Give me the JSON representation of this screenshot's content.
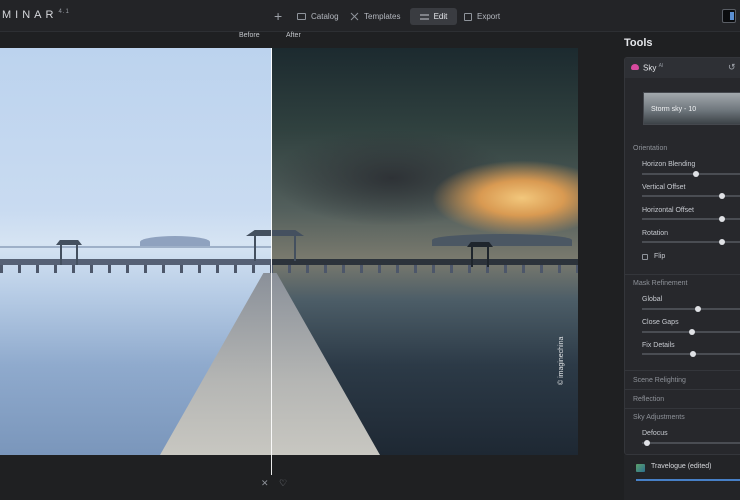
{
  "app": {
    "logo_text": "MINAR",
    "logo_version": "4.1"
  },
  "toolbar": {
    "add_label": "+",
    "catalog_label": "Catalog",
    "templates_label": "Templates",
    "edit_label": "Edit",
    "export_label": "Export"
  },
  "canvas": {
    "before_label": "Before",
    "after_label": "After",
    "watermark": "© imaginechina",
    "close_symbol": "✕",
    "heart_symbol": "♡"
  },
  "tools": {
    "title": "Tools",
    "sky": {
      "name": "Sky",
      "badge": "AI",
      "preset": "Storm sky - 10"
    },
    "orientation": {
      "title": "Orientation",
      "sliders": [
        {
          "label": "Horizon Blending",
          "value": 0.55
        },
        {
          "label": "Vertical Offset",
          "value": 0.83
        },
        {
          "label": "Horizontal Offset",
          "value": 0.83
        },
        {
          "label": "Rotation",
          "value": 0.83
        }
      ],
      "flip_label": "Flip",
      "flip_checked": false
    },
    "mask_refinement": {
      "title": "Mask Refinement",
      "sliders": [
        {
          "label": "Global",
          "value": 0.57
        },
        {
          "label": "Close Gaps",
          "value": 0.5
        },
        {
          "label": "Fix Details",
          "value": 0.52
        }
      ]
    },
    "sections": [
      "Scene Relighting",
      "Reflection",
      "Sky Adjustments"
    ],
    "sky_adjustments": {
      "sliders": [
        {
          "label": "Defocus",
          "value": 0.02
        }
      ]
    }
  },
  "preset_bar": {
    "label": "Travelogue (edited)"
  },
  "colors": {
    "accent": "#4780c7",
    "sky_icon": "#d84a9f",
    "edit_active_bg": "#3a3c41"
  }
}
